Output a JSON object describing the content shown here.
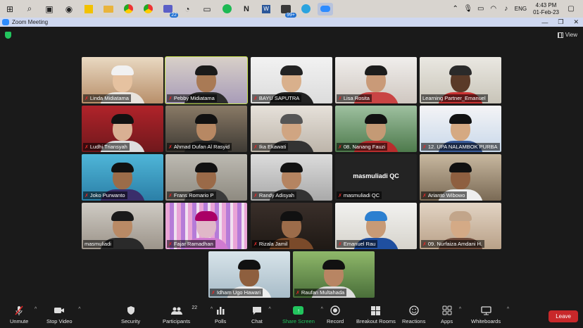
{
  "taskbar": {
    "icons": [
      "windows-start-icon",
      "search-icon",
      "task-view-icon",
      "obs-icon",
      "sticky-notes-icon",
      "file-explorer-icon",
      "chrome-icon",
      "chrome-icon",
      "teams-icon",
      "steam-icon",
      "vmware-icon",
      "spotify-icon",
      "notion-icon",
      "word-icon",
      "whatsapp-icon",
      "telegram-icon",
      "zoom-icon"
    ],
    "badges": {
      "teams": "22",
      "whatsapp": "99+"
    },
    "language": "ENG",
    "time": "4:43 PM",
    "date": "01-Feb-23"
  },
  "window": {
    "title": "Zoom Meeting",
    "view_label": "View"
  },
  "participants": [
    {
      "name": "Linda Midiatama",
      "muted": true
    },
    {
      "name": "Pebby Midiatama",
      "muted": true,
      "active": true
    },
    {
      "name": "BAYU SAPUTRA",
      "muted": true
    },
    {
      "name": "Lisa Rosita",
      "muted": true
    },
    {
      "name": "Learning Partner_Emanuel",
      "muted": false
    },
    {
      "name": "Ludhi Triansyah",
      "muted": true
    },
    {
      "name": "Ahmad Dufan Al Rasyid",
      "muted": true
    },
    {
      "name": "Ika Ekawati",
      "muted": true
    },
    {
      "name": "08. Nanang Fauzi",
      "muted": true
    },
    {
      "name": "12. UPA NALAMBOK PURBA",
      "muted": true
    },
    {
      "name": "Joko Purwanto",
      "muted": true
    },
    {
      "name": "Frans Romario P",
      "muted": true
    },
    {
      "name": "Randy Adisyah",
      "muted": true
    },
    {
      "name": "masmuliadi QC",
      "muted": true,
      "video": false
    },
    {
      "name": "Arianto Wibowo",
      "muted": true
    },
    {
      "name": "masmuliadi",
      "muted": false
    },
    {
      "name": "Fajar Ramadhan",
      "muted": true
    },
    {
      "name": "Rizala Jamil",
      "muted": true
    },
    {
      "name": "Emanuel Rau",
      "muted": true
    },
    {
      "name": "09. Nurfaiza Amdani H.",
      "muted": true
    },
    {
      "name": "Idham Ugo Hawari",
      "muted": true
    },
    {
      "name": "Raufan Multahada",
      "muted": true
    }
  ],
  "toolbar": {
    "unmute": "Unmute",
    "stop_video": "Stop Video",
    "security": "Security",
    "participants": "Participants",
    "participants_count": "22",
    "polls": "Polls",
    "chat": "Chat",
    "share_screen": "Share Screen",
    "record": "Record",
    "breakout_rooms": "Breakout Rooms",
    "reactions": "Reactions",
    "apps": "Apps",
    "whiteboards": "Whiteboards",
    "leave": "Leave"
  },
  "colors": {
    "accent_green": "#22c55e",
    "leave_red": "#c8282a",
    "active_outline": "#c5e04e",
    "zoom_blue": "#2d8cff"
  }
}
